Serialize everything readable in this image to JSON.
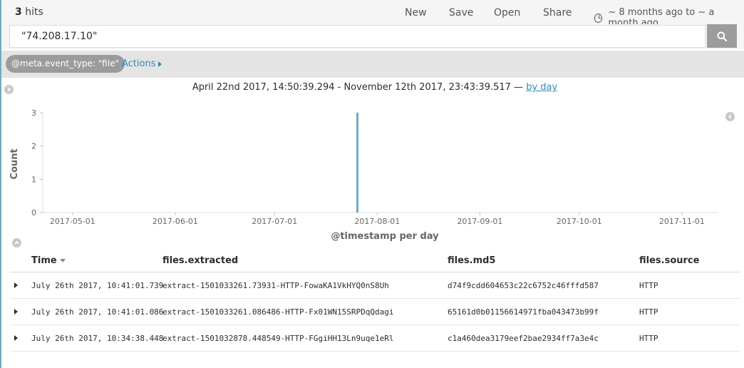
{
  "toolbar": {
    "hits_count": "3",
    "hits_label": "hits",
    "new_label": "New",
    "save_label": "Save",
    "open_label": "Open",
    "share_label": "Share",
    "timerange_label": "~ 8 months ago to ~ a month ago"
  },
  "search": {
    "query": "\"74.208.17.10\"",
    "button_icon": "search-icon"
  },
  "filters": {
    "pill_label": "@meta.event_type: \"file\"",
    "actions_label": "Actions"
  },
  "histogram": {
    "range_text": "April 22nd 2017, 14:50:39.294 - November 12th 2017, 23:43:39.517 —",
    "interval_link": "by day"
  },
  "chart_data": {
    "type": "bar",
    "xlabel": "@timestamp per day",
    "ylabel": "Count",
    "ylim": [
      0,
      3
    ],
    "yticks": [
      "0",
      "1",
      "2",
      "3"
    ],
    "xlim": [
      "2017-04-22",
      "2017-11-12"
    ],
    "xticks": [
      "2017-05-01",
      "2017-06-01",
      "2017-07-01",
      "2017-08-01",
      "2017-09-01",
      "2017-10-01",
      "2017-11-01"
    ],
    "grid": false,
    "color": "#6eadc1",
    "x": [
      "2017-07-26"
    ],
    "values": [
      3
    ]
  },
  "table": {
    "columns": [
      "Time",
      "files.extracted",
      "files.md5",
      "files.source"
    ],
    "rows": [
      {
        "time": "July 26th 2017, 10:41:01.739",
        "extracted": "extract-1501033261.73931-HTTP-FowaKA1VkHYQ0nS8Uh",
        "md5": "d74f9cdd604653c22c6752c46fffd587",
        "source": "HTTP"
      },
      {
        "time": "July 26th 2017, 10:41:01.086",
        "extracted": "extract-1501033261.086486-HTTP-Fx01WN15SRPDqQdagi",
        "md5": "65161d0b01156614971fba043473b99f",
        "source": "HTTP"
      },
      {
        "time": "July 26th 2017, 10:34:38.448",
        "extracted": "extract-1501032878.448549-HTTP-FGgiHH13Ln9uqe1eRl",
        "md5": "c1a460dea3179eef2bae2934ff7a3e4c",
        "source": "HTTP"
      }
    ]
  }
}
